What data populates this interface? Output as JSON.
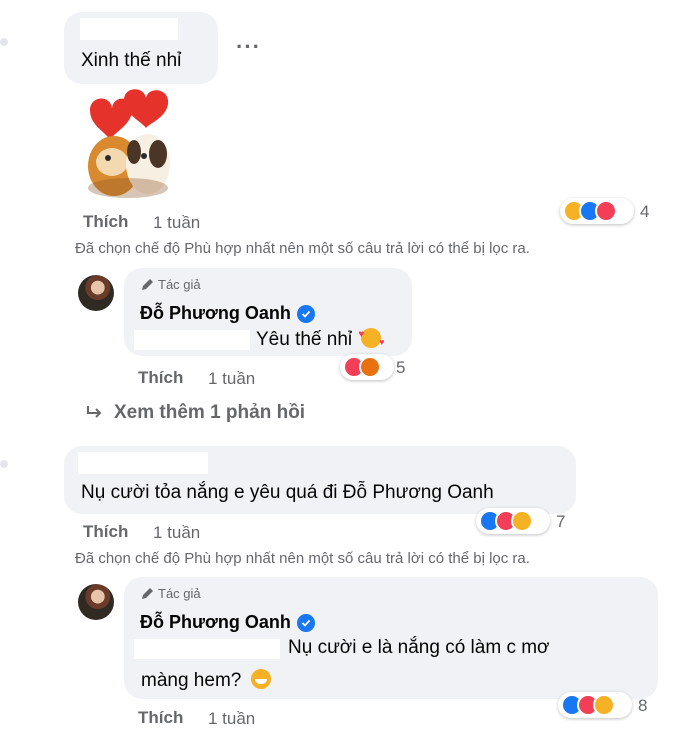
{
  "comment1": {
    "text": "Xinh thế nhỉ",
    "like_label": "Thích",
    "time": "1 tuần",
    "reaction_count": "4",
    "reaction_icons": [
      "care-icon",
      "like-icon",
      "love-icon"
    ]
  },
  "notice1": "Đã chọn chế độ Phù hợp nhất nên một số câu trả lời có thể bị lọc ra.",
  "reply1": {
    "badge": "Tác giả",
    "author": "Đỗ Phương Oanh",
    "text": "Yêu thế nhỉ",
    "like_label": "Thích",
    "time": "1 tuần",
    "reaction_count": "5",
    "reaction_icons": [
      "love-icon",
      "angry-icon"
    ]
  },
  "view_more": "Xem thêm 1 phản hồi",
  "comment2": {
    "text": "Nụ cười tỏa nắng e yêu quá đi ",
    "mention": "Đỗ Phương Oanh",
    "like_label": "Thích",
    "time": "1 tuần",
    "reaction_count": "7",
    "reaction_icons": [
      "like-icon",
      "love-icon",
      "care-icon"
    ]
  },
  "notice2": "Đã chọn chế độ Phù hợp nhất nên một số câu trả lời có thể bị lọc ra.",
  "reply2": {
    "badge": "Tác giả",
    "author": "Đỗ Phương Oanh",
    "text_line1": "Nụ cười e là nắng có làm c mơ",
    "text_line2": "màng hem?",
    "like_label": "Thích",
    "time": "1 tuần",
    "reaction_count": "8",
    "reaction_icons": [
      "like-icon",
      "love-icon",
      "haha-icon"
    ]
  },
  "colors": {
    "bubble": "#f0f2f5",
    "meta": "#65676b",
    "like": "#1877f2",
    "love": "#f33e58",
    "care": "#f7b125",
    "angry": "#e9710f"
  }
}
